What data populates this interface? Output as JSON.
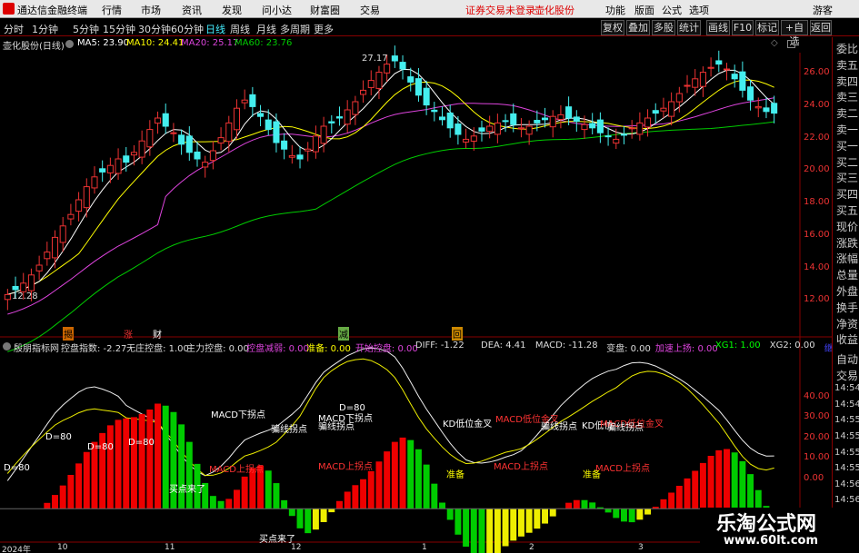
{
  "menubar": {
    "app_title": "通达信金融终端",
    "items": [
      "行情",
      "市场",
      "资讯",
      "发现",
      "问小达",
      "财富圈",
      "交易"
    ],
    "status": "证券交易未登录",
    "stock": "壶化股份",
    "right": [
      "功能",
      "版面",
      "公式",
      "选项",
      "游客"
    ]
  },
  "toolbar": {
    "periods": [
      "分时",
      "1分钟",
      "5分钟",
      "15分钟",
      "30分钟",
      "60分钟",
      "日线",
      "周线",
      "月线",
      "多周期",
      "更多"
    ],
    "selected": "日线",
    "right": [
      "复权",
      "叠加",
      "多股",
      "统计",
      "画线",
      "F10",
      "标记",
      "+自选",
      "返回"
    ]
  },
  "infobar": {
    "title": "壶化股份(日线)",
    "ma5": "MA5: 23.90",
    "ma10": "MA10: 24.41",
    "ma20": "MA20: 25.17",
    "ma60": "MA60: 23.76"
  },
  "price_axis": [
    "26.00",
    "24.00",
    "22.00",
    "20.00",
    "18.00",
    "16.00",
    "14.00",
    "12.00"
  ],
  "high_low": {
    "high": "27.17",
    "low": "12.28"
  },
  "event_marks": [
    "揭",
    "涨",
    "财",
    "减",
    "回"
  ],
  "indicator_bar": {
    "name": "殷朋指标网",
    "items": [
      {
        "text": "控盘指数: -2.27",
        "c": "#ddd"
      },
      {
        "text": "无庄控盘: 1.00",
        "c": "#ddd"
      },
      {
        "text": "主力控盘: 0.00",
        "c": "#ddd"
      },
      {
        "text": "控盘减弱: 0.00",
        "c": "#d4d"
      },
      {
        "text": "准备: 0.00",
        "c": "#ff0"
      },
      {
        "text": "开始控盘: 0.00",
        "c": "#d4d"
      },
      {
        "text": "DIFF: -1.22",
        "c": "#ddd"
      },
      {
        "text": "DEA: 4.41",
        "c": "#ddd"
      },
      {
        "text": "MACD: -11.28",
        "c": "#ddd"
      },
      {
        "text": "变盘: 0.00",
        "c": "#ddd"
      },
      {
        "text": "加速上扬: 0.00",
        "c": "#d4d"
      },
      {
        "text": "XG1: 1.00",
        "c": "#0f0"
      },
      {
        "text": "XG2: 0.00",
        "c": "#ddd"
      },
      {
        "text": "继续进入",
        "c": "#44f"
      }
    ]
  },
  "ind_axis": [
    "40.00",
    "30.00",
    "20.00",
    "10.00",
    "0.00"
  ],
  "date_axis": [
    "2024年",
    "10",
    "11",
    "12",
    "1",
    "2",
    "3"
  ],
  "right_panel": [
    "委比",
    "卖五",
    "卖四",
    "卖三",
    "卖二",
    "卖一",
    "买一",
    "买二",
    "买三",
    "买四",
    "买五",
    "现价",
    "涨跌",
    "涨幅",
    "总量",
    "外盘",
    "换手",
    "净资",
    "收益",
    "自动",
    "交易",
    "14:54",
    "14:54",
    "14:55",
    "14:55",
    "14:55",
    "14:55",
    "14:56",
    "14:56",
    "14:56",
    "14:56"
  ],
  "annotations": [
    {
      "t": "D=80",
      "c": "#fff",
      "x": 4,
      "y": 510
    },
    {
      "t": "D=80",
      "c": "#fff",
      "x": 50,
      "y": 476
    },
    {
      "t": "D=80",
      "c": "#fff",
      "x": 96,
      "y": 487
    },
    {
      "t": "D=80",
      "c": "#fff",
      "x": 141,
      "y": 482
    },
    {
      "t": "MACD下拐点",
      "c": "#fff",
      "x": 232,
      "y": 448
    },
    {
      "t": "MACD上拐点",
      "c": "#f33",
      "x": 230,
      "y": 508
    },
    {
      "t": "骗线拐点",
      "c": "#fff",
      "x": 298,
      "y": 464
    },
    {
      "t": "D=80",
      "c": "#fff",
      "x": 373,
      "y": 444
    },
    {
      "t": "MACD下拐点",
      "c": "#fff",
      "x": 350,
      "y": 452
    },
    {
      "t": "骗线拐点",
      "c": "#fff",
      "x": 350,
      "y": 461
    },
    {
      "t": "MACD上拐点",
      "c": "#f33",
      "x": 350,
      "y": 505
    },
    {
      "t": "KD低位金叉",
      "c": "#fff",
      "x": 487,
      "y": 458
    },
    {
      "t": "MACD低位金叉",
      "c": "#f33",
      "x": 545,
      "y": 453
    },
    {
      "t": "MACD上拐点",
      "c": "#f33",
      "x": 543,
      "y": 505
    },
    {
      "t": "骗线拐点",
      "c": "#fff",
      "x": 595,
      "y": 461
    },
    {
      "t": "KD低位",
      "c": "#fff",
      "x": 640,
      "y": 460
    },
    {
      "t": "MACD低位金叉",
      "c": "#f33",
      "x": 660,
      "y": 458
    },
    {
      "t": "骗线拐点",
      "c": "#fff",
      "x": 668,
      "y": 462
    },
    {
      "t": "MACD上拐点",
      "c": "#f33",
      "x": 655,
      "y": 507
    },
    {
      "t": "准备",
      "c": "#ff0",
      "x": 491,
      "y": 514
    },
    {
      "t": "准备",
      "c": "#ff0",
      "x": 641,
      "y": 514
    },
    {
      "t": "买点来了",
      "c": "#fff",
      "x": 186,
      "y": 530
    },
    {
      "t": "买点来了",
      "c": "#fff",
      "x": 285,
      "y": 585
    }
  ],
  "watermark": {
    "line1": "乐淘公式网",
    "line2": "www.60lt.com"
  },
  "colors": {
    "up": "#e33",
    "down": "#4ee",
    "ma5": "#fff",
    "ma10": "#ff0",
    "ma20": "#d4d",
    "ma60": "#0c0"
  },
  "chart_data": {
    "type": "candlestick",
    "close": [
      12.7,
      13.0,
      13.4,
      13.9,
      14.5,
      15.3,
      16.2,
      16.9,
      17.6,
      18.5,
      19.3,
      19.9,
      20.2,
      20.6,
      21.0,
      20.8,
      21.4,
      22.1,
      22.8,
      23.5,
      23.0,
      22.6,
      21.9,
      21.4,
      21.0,
      20.8,
      21.5,
      22.3,
      23.2,
      24.1,
      24.6,
      24.2,
      23.6,
      22.8,
      22.0,
      21.6,
      21.2,
      21.0,
      21.6,
      22.4,
      23.0,
      23.2,
      23.5,
      24.0,
      24.5,
      25.2,
      25.8,
      26.3,
      26.8,
      27.0,
      26.5,
      25.7,
      24.9,
      24.3,
      23.9,
      23.4,
      22.9,
      22.5,
      22.2,
      22.4,
      22.7,
      23.0,
      23.2,
      23.3,
      23.1,
      22.9,
      23.0,
      23.2,
      23.4,
      23.6,
      23.7,
      23.5,
      23.3,
      23.1,
      22.9,
      22.6,
      22.4,
      22.2,
      22.5,
      22.9,
      23.2,
      23.5,
      23.8,
      24.1,
      24.5,
      25.0,
      25.5,
      25.9,
      26.3,
      26.6,
      26.8,
      26.5,
      25.9,
      25.2,
      24.6,
      24.2,
      23.9,
      23.8
    ],
    "ylim": [
      11,
      27.5
    ],
    "indicator_ylim": [
      -10,
      45
    ]
  }
}
